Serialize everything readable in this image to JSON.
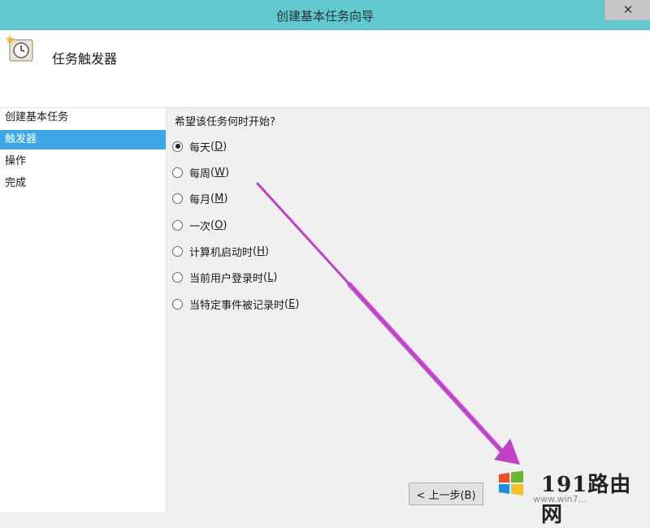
{
  "window": {
    "title": "创建基本任务向导",
    "close_glyph": "✕"
  },
  "header": {
    "title": "任务触发器",
    "icon": "scheduled-task-clock-icon"
  },
  "sidebar": {
    "items": [
      {
        "label": "创建基本任务",
        "active": false
      },
      {
        "label": "触发器",
        "active": true
      },
      {
        "label": "操作",
        "active": false
      },
      {
        "label": "完成",
        "active": false
      }
    ]
  },
  "main": {
    "question": "希望该任务何时开始?",
    "options": [
      {
        "label": "每天",
        "key": "D",
        "selected": true
      },
      {
        "label": "每周",
        "key": "W",
        "selected": false
      },
      {
        "label": "每月",
        "key": "M",
        "selected": false
      },
      {
        "label": "一次",
        "key": "O",
        "selected": false
      },
      {
        "label": "计算机启动时",
        "key": "H",
        "selected": false
      },
      {
        "label": "当前用户登录时",
        "key": "L",
        "selected": false
      },
      {
        "label": "当特定事件被记录时",
        "key": "E",
        "selected": false
      }
    ]
  },
  "footer": {
    "back_button": "< 上一步(B)"
  },
  "watermark": {
    "text": "191路由网",
    "url": "www.win7..."
  },
  "colors": {
    "titlebar": "#63c9d0",
    "selection": "#3fa7e6",
    "arrow": "#c040c8"
  }
}
